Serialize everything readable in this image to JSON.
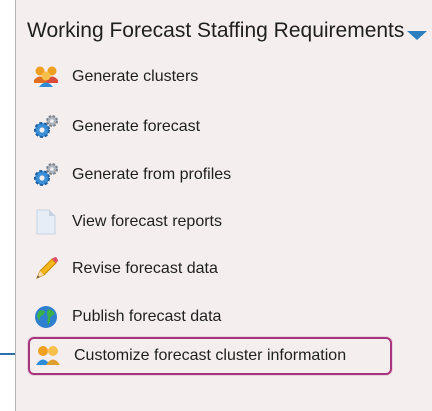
{
  "header": {
    "title": "Working Forecast Staffing Requirements"
  },
  "menu": {
    "items": [
      {
        "label": "Generate clusters",
        "icon": "people-group-icon"
      },
      {
        "label": "Generate forecast",
        "icon": "gears-icon"
      },
      {
        "label": "Generate from profiles",
        "icon": "gears-icon"
      },
      {
        "label": "View forecast reports",
        "icon": "document-icon"
      },
      {
        "label": "Revise forecast data",
        "icon": "pencil-icon"
      },
      {
        "label": "Publish forecast data",
        "icon": "globe-icon"
      },
      {
        "label": "Customize forecast cluster information",
        "icon": "people-pair-icon"
      }
    ]
  },
  "colors": {
    "accent": "#2d7fc0",
    "highlight": "#a8347d"
  }
}
